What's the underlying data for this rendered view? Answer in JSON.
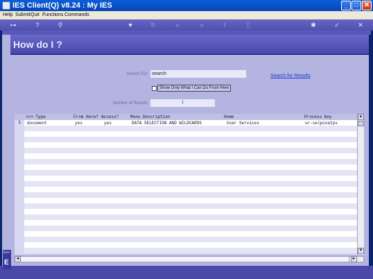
{
  "window": {
    "title": "IES Client(Q) v8.24 : My IES",
    "buttons": [
      "_",
      "□",
      "✕"
    ]
  },
  "menu": [
    "Help",
    "Submit",
    "Quit",
    "Functions",
    "Commands"
  ],
  "toolbar": {
    "icons": [
      "key-icon",
      "help-icon",
      "search-icon",
      "heart-icon",
      "refresh-icon",
      "rewind-icon",
      "forward-icon",
      "export-icon",
      "copy-icon",
      "settings-icon",
      "check-icon",
      "close-icon"
    ],
    "glyphs": {
      "key": "⊶",
      "help": "?",
      "search": "⚲",
      "heart": "♥",
      "refresh": "↻",
      "rewind": "«",
      "forward": "»",
      "export": "⇪",
      "copy": "▯",
      "settings": "✱",
      "check": "✓",
      "close": "✕"
    }
  },
  "page": {
    "heading": "How do I ?"
  },
  "form": {
    "search_label": "Search For:",
    "search_value": "search",
    "checkbox_label": "Show Only What I Can Do From Here",
    "checkbox_checked": false,
    "search_link": "Search for Results",
    "results_label": "Number of Results:",
    "results_value": "1"
  },
  "grid": {
    "columns": [
      ">>> Type",
      "From Here?",
      "Access?",
      "Menu Description",
      "Home",
      "Process Key"
    ],
    "rows": [
      {
        "num": "1",
        "type": "document",
        "from_here": "yes",
        "access": "yes",
        "description": "DATA SELECTION AND WILDCARDS",
        "home": "User Services",
        "process_key": "ur-selpcoatps"
      }
    ],
    "scroll": {
      "up": "▲",
      "down": "▼",
      "left": "◄",
      "right": "►"
    }
  },
  "side_tab": {
    "top": "Serv",
    "letter": "E"
  },
  "colors": {
    "titlebar": "#0a5fd8",
    "toolbar": "#5a58b8",
    "content": "#b4b4e0",
    "link": "#1a38c8"
  }
}
